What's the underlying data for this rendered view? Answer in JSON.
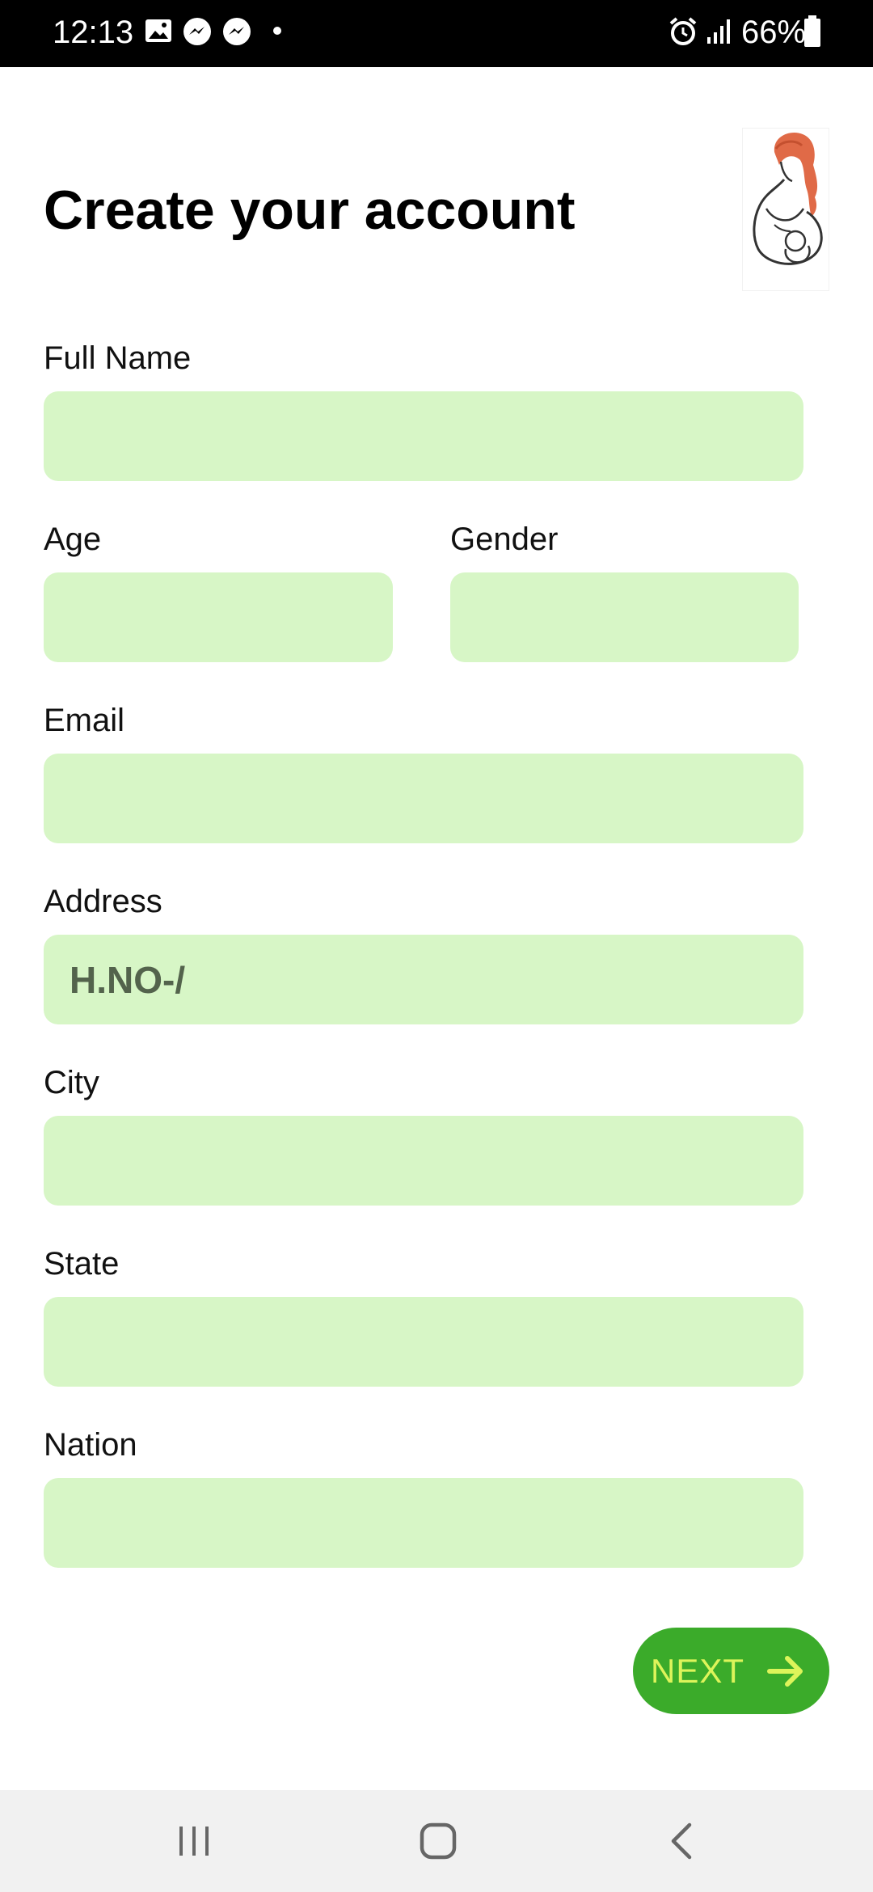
{
  "status_bar": {
    "time": "12:13",
    "battery": "66%",
    "icons": [
      "image-icon",
      "messenger-icon",
      "messenger-icon",
      "dot-icon",
      "alarm-icon",
      "signal-icon",
      "battery-icon"
    ]
  },
  "header": {
    "title": "Create your account",
    "logo_icon": "pregnant-woman-logo-icon"
  },
  "form": {
    "full_name": {
      "label": "Full Name",
      "value": ""
    },
    "age": {
      "label": "Age",
      "value": ""
    },
    "gender": {
      "label": "Gender",
      "value": ""
    },
    "email": {
      "label": "Email",
      "value": ""
    },
    "address": {
      "label": "Address",
      "value": "H.NO-/"
    },
    "city": {
      "label": "City",
      "value": ""
    },
    "state": {
      "label": "State",
      "value": ""
    },
    "nation": {
      "label": "Nation",
      "value": ""
    }
  },
  "next_button": {
    "label": "NEXT",
    "icon": "arrow-right-icon"
  },
  "colors": {
    "field_background": "#d7f6c6",
    "button_background": "#3bab2a",
    "button_text": "#ddf45a",
    "status_bar": "#000000"
  },
  "nav_bar": {
    "icons": [
      "recent-apps-icon",
      "home-icon",
      "back-icon"
    ]
  }
}
